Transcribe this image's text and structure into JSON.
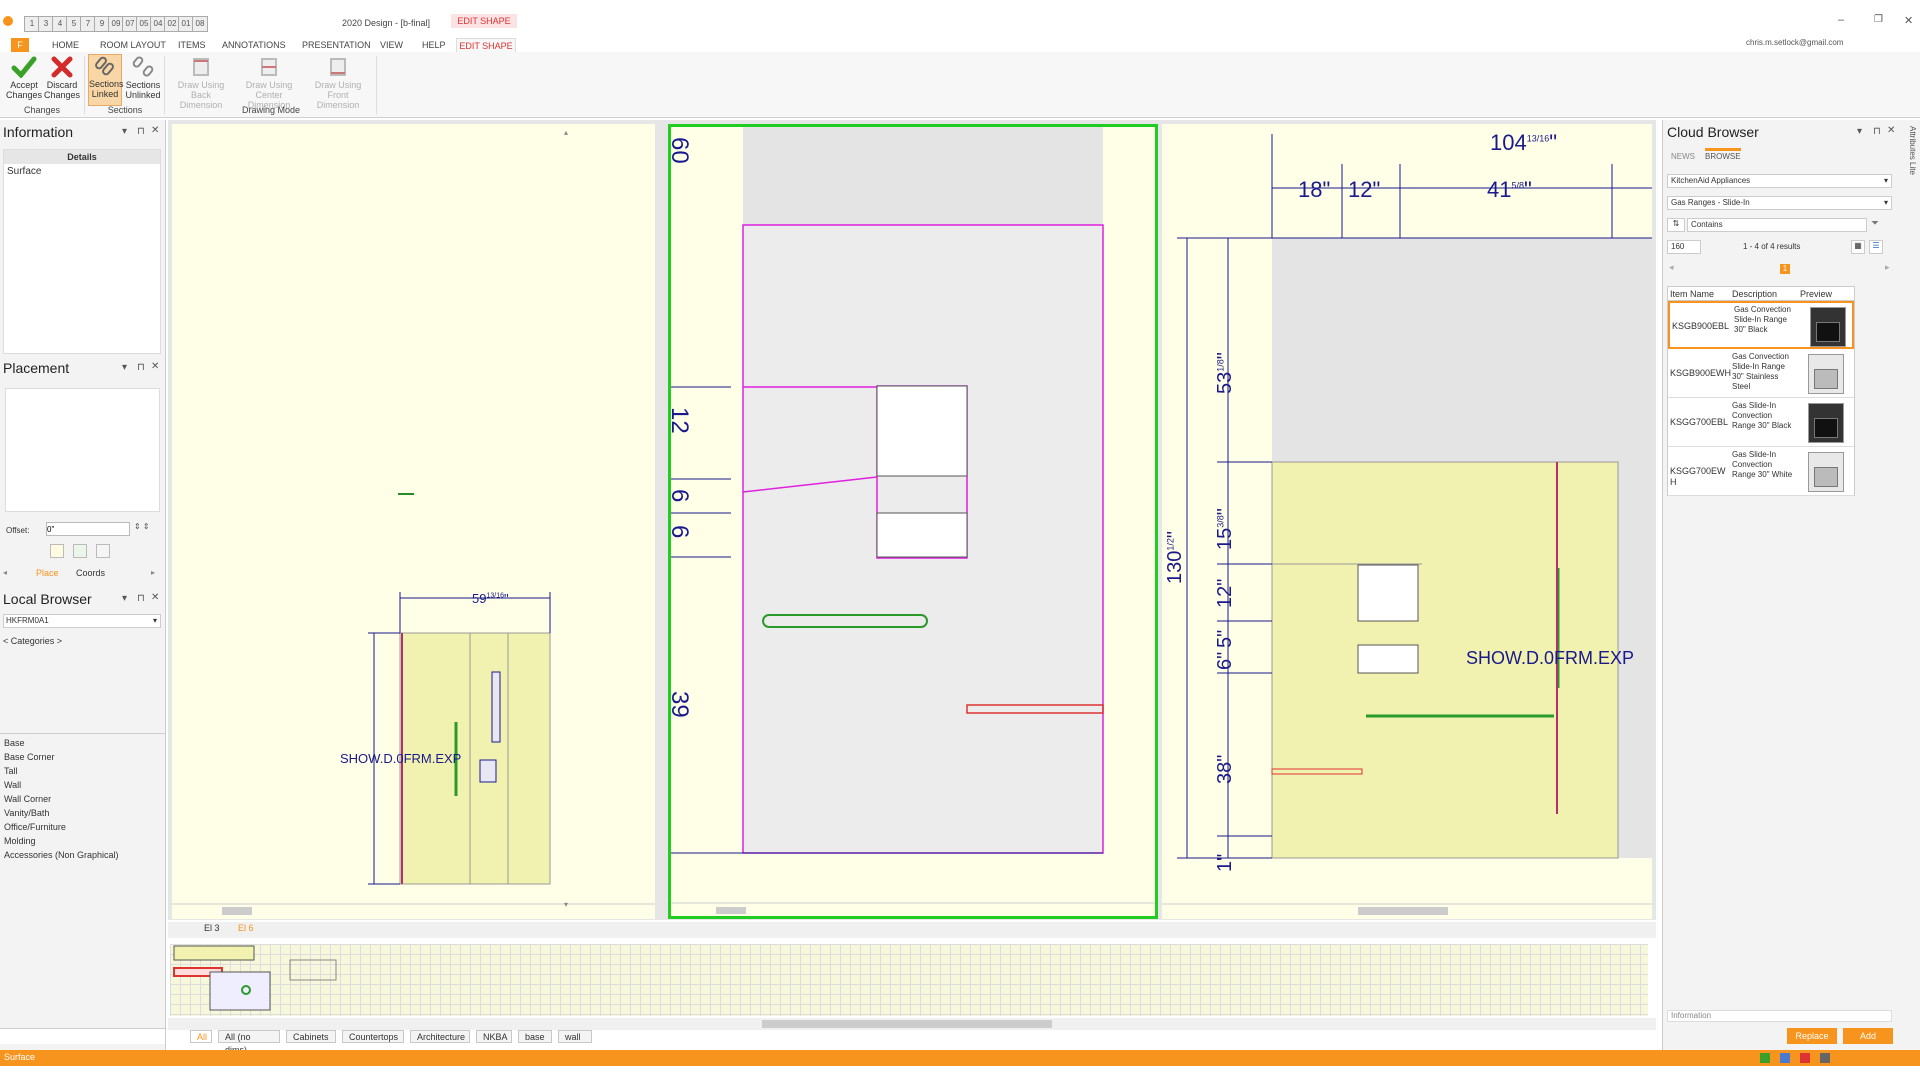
{
  "app": {
    "title": "2020 Design - [b-final]",
    "context_tab": "EDIT SHAPE",
    "user": "chris.m.setlock@gmail.com"
  },
  "qat": [
    "1",
    "3",
    "4",
    "5",
    "7",
    "9",
    "09",
    "07",
    "05",
    "04",
    "02",
    "01",
    "08"
  ],
  "ribbon_tabs": [
    {
      "label": "F",
      "key": ""
    },
    {
      "label": "HOME",
      "key": "H"
    },
    {
      "label": "ROOM LAYOUT",
      "key": "R"
    },
    {
      "label": "ITEMS",
      "key": "I"
    },
    {
      "label": "ANNOTATIONS",
      "key": "A"
    },
    {
      "label": "PRESENTATION",
      "key": "P"
    },
    {
      "label": "VIEW",
      "key": "V"
    },
    {
      "label": "HELP",
      "key": "E"
    },
    {
      "label": "EDIT SHAPE",
      "key": "E"
    }
  ],
  "ribbon": {
    "accept": "Accept Changes",
    "discard": "Discard Changes",
    "linked": "Sections Linked",
    "unlinked": "Sections Unlinked",
    "draw_back": "Draw Using Back Dimension",
    "draw_center": "Draw Using Center Dimension",
    "draw_front": "Draw Using Front Dimension",
    "group_changes": "Changes",
    "group_sections": "Sections",
    "group_drawing": "Drawing Mode"
  },
  "information": {
    "title": "Information",
    "details_header": "Details",
    "row": "Surface"
  },
  "placement": {
    "title": "Placement",
    "offset_label": "Offset:",
    "offset_value": "0\"",
    "tab_place": "Place",
    "tab_coords": "Coords"
  },
  "local_browser": {
    "title": "Local Browser",
    "catalog": "HKFRM0A1",
    "categories": "< Categories >",
    "items": [
      "Base",
      "Base Corner",
      "Tall",
      "Wall",
      "Wall Corner",
      "Vanity/Bath",
      "Office/Furniture",
      "Molding",
      "Accessories (Non Graphical)"
    ]
  },
  "views": {
    "left": {
      "dim_width": "59",
      "dim_width_frac": "13/16",
      "label": "SHOW.D.0FRM.EXP"
    },
    "middle": {
      "dims": [
        "60",
        "12",
        "6",
        "6",
        "39"
      ]
    },
    "right": {
      "top_total": "104",
      "top_total_frac": "13/16",
      "top_a": "18\"",
      "top_b": "12\"",
      "top_c": "41",
      "top_c_frac": "5/8",
      "v_total": "130",
      "v_total_frac": "1/2",
      "v_dims": [
        "53",
        "15",
        "12\"",
        "6\"",
        "5\"",
        "38\"",
        "1\""
      ],
      "v_fracs": [
        "1/8",
        "3/8"
      ],
      "label": "SHOW.D.0FRM.EXP"
    }
  },
  "view_tabs": [
    "El 3",
    "El 6"
  ],
  "layer_tabs": [
    "All",
    "All (no dims)",
    "Cabinets",
    "Countertops",
    "Architecture",
    "NKBA",
    "base",
    "wall"
  ],
  "cloud_browser": {
    "title": "Cloud Browser",
    "tab_news": "NEWS",
    "tab_browse": "BROWSE",
    "manufacturer": "KitchenAid Appliances",
    "category": "Gas Ranges - Slide-In",
    "filter_mode": "Contains",
    "page_size": "160",
    "results": "1 - 4 of 4 results",
    "page": "1",
    "columns": [
      "Item Name",
      "Description",
      "Preview"
    ],
    "rows": [
      {
        "name": "KSGB900EBL",
        "desc": "Gas Convection Slide-In Range 30\" Black",
        "finish": "black"
      },
      {
        "name": "KSGB900EWH",
        "desc": "Gas Convection Slide-In Range 30\" Stainless Steel",
        "finish": "white"
      },
      {
        "name": "KSGG700EBL",
        "desc": "Gas Slide-In Convection Range 30\" Black",
        "finish": "black"
      },
      {
        "name": "KSGG700EW H",
        "desc": "Gas Slide-In Convection Range 30\" White",
        "finish": "white"
      }
    ],
    "info_label": "Information",
    "replace": "Replace",
    "add": "Add",
    "side_tab": "Attributes Lite"
  },
  "status": {
    "text": "Surface"
  },
  "colors": {
    "accent": "#f7941d",
    "canvas": "#ffffe8",
    "selection": "#e020e0",
    "dimension": "#1a1a8c",
    "active_view": "#22cc22"
  }
}
